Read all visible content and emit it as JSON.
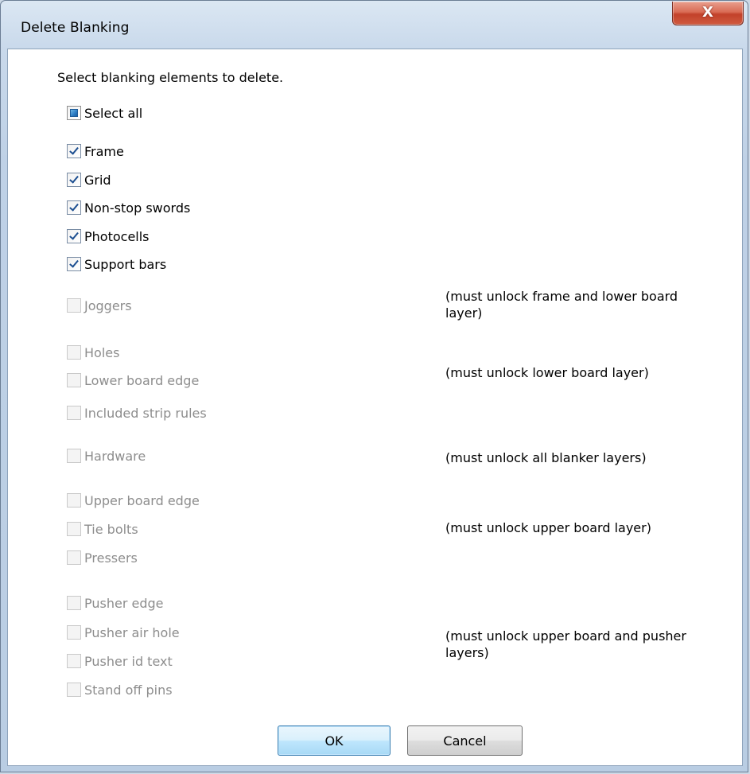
{
  "window": {
    "title": "Delete Blanking",
    "close_glyph": "X",
    "close_icon": "close-icon"
  },
  "intro": "Select blanking elements to delete.",
  "select_all": {
    "label": "Select all",
    "state": "indeterminate"
  },
  "enabled_items": [
    {
      "label": "Frame",
      "checked": true
    },
    {
      "label": "Grid",
      "checked": true
    },
    {
      "label": "Non-stop swords",
      "checked": true
    },
    {
      "label": "Photocells",
      "checked": true
    },
    {
      "label": "Support bars",
      "checked": true
    }
  ],
  "disabled_items": [
    {
      "label": "Joggers",
      "checked": false,
      "enabled": false
    },
    {
      "label": "Holes",
      "checked": false,
      "enabled": false
    },
    {
      "label": "Lower board edge",
      "checked": false,
      "enabled": false
    },
    {
      "label": "Included strip rules",
      "checked": false,
      "enabled": false
    },
    {
      "label": "Hardware",
      "checked": false,
      "enabled": false
    },
    {
      "label": "Upper board edge",
      "checked": false,
      "enabled": false
    },
    {
      "label": "Tie bolts",
      "checked": false,
      "enabled": false
    },
    {
      "label": "Pressers",
      "checked": false,
      "enabled": false
    },
    {
      "label": "Pusher edge",
      "checked": false,
      "enabled": false
    },
    {
      "label": "Pusher air hole",
      "checked": false,
      "enabled": false
    },
    {
      "label": "Pusher id text",
      "checked": false,
      "enabled": false
    },
    {
      "label": "Stand off pins",
      "checked": false,
      "enabled": false
    }
  ],
  "notes": {
    "joggers": "(must unlock frame and lower board layer)",
    "lower_board": "(must unlock lower board layer)",
    "all_blanker": "(must unlock all blanker layers)",
    "upper_board": "(must unlock upper board layer)",
    "pusher": "(must unlock upper board and pusher layers)"
  },
  "buttons": {
    "ok": "OK",
    "cancel": "Cancel"
  },
  "colors": {
    "title_bar": "#c9d9eb",
    "close_button": "#c2412a",
    "disabled_text": "#8d8d8d",
    "check_mark": "#1d4f91"
  }
}
